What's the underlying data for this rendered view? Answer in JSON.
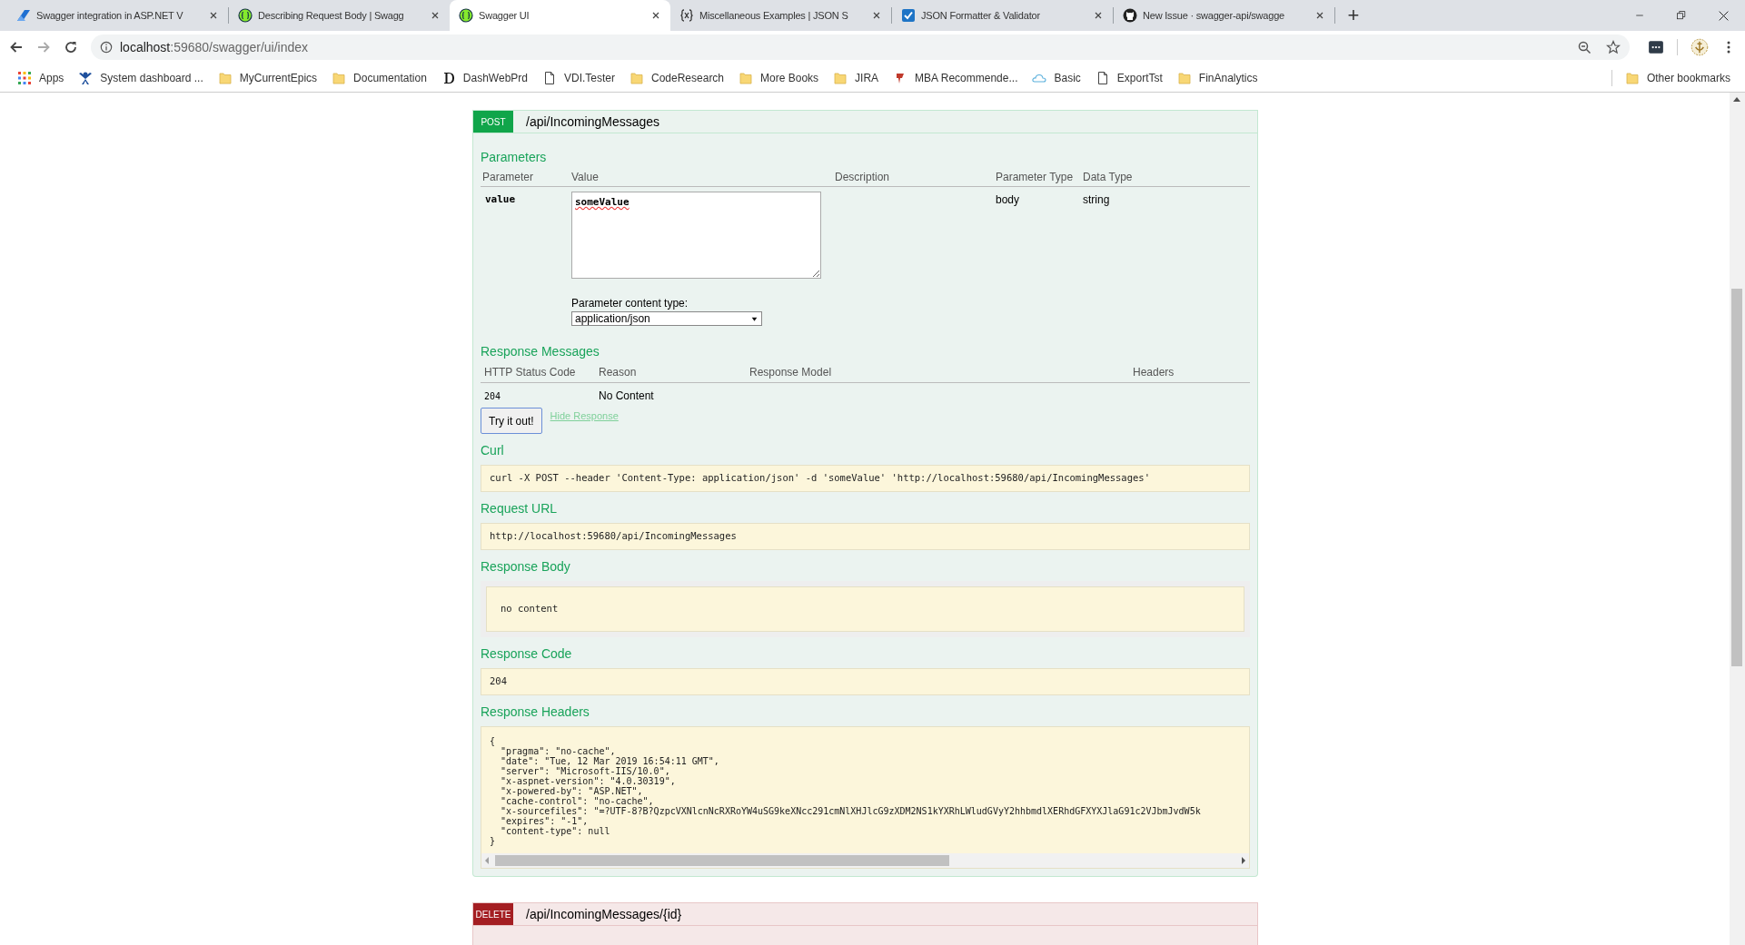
{
  "browser": {
    "tabs": [
      {
        "title": "Swagger integration in ASP.NET V",
        "kind": "logo",
        "selected": false
      },
      {
        "title": "Describing Request Body | Swagg",
        "kind": "swagger",
        "selected": false
      },
      {
        "title": "Swagger UI",
        "kind": "swagger",
        "selected": true
      },
      {
        "title": "Miscellaneous Examples | JSON S",
        "kind": "braces",
        "selected": false
      },
      {
        "title": "JSON Formatter & Validator",
        "kind": "check",
        "selected": false
      },
      {
        "title": "New Issue · swagger-api/swagge",
        "kind": "github",
        "selected": false
      }
    ],
    "new_tab": "+",
    "address": {
      "host": "localhost",
      "rest": ":59680/swagger/ui/index"
    },
    "bookmarks": [
      {
        "label": "Apps",
        "kind": "apps"
      },
      {
        "label": "System dashboard ...",
        "kind": "person"
      },
      {
        "label": "MyCurrentEpics",
        "kind": "folder"
      },
      {
        "label": "Documentation",
        "kind": "folder"
      },
      {
        "label": "DashWebPrd",
        "kind": "letter"
      },
      {
        "label": "VDI.Tester",
        "kind": "page"
      },
      {
        "label": "CodeResearch",
        "kind": "folder"
      },
      {
        "label": "More Books",
        "kind": "folder"
      },
      {
        "label": "JIRA",
        "kind": "folder"
      },
      {
        "label": "MBA Recommende...",
        "kind": "pin"
      },
      {
        "label": "Basic",
        "kind": "cloud"
      },
      {
        "label": "ExportTst",
        "kind": "page"
      },
      {
        "label": "FinAnalytics",
        "kind": "folder"
      }
    ],
    "other_bookmarks": "Other bookmarks"
  },
  "operations": [
    {
      "method": "POST",
      "path": "/api/IncomingMessages",
      "parameters": {
        "title": "Parameters",
        "columns": [
          "Parameter",
          "Value",
          "Description",
          "Parameter Type",
          "Data Type"
        ],
        "rows": [
          {
            "name": "value",
            "value": "someValue",
            "parameter_type": "body",
            "data_type": "string"
          }
        ],
        "content_type_label": "Parameter content type:",
        "content_type": "application/json"
      },
      "responses": {
        "title": "Response Messages",
        "columns": [
          "HTTP Status Code",
          "Reason",
          "Response Model",
          "Headers"
        ],
        "rows": [
          {
            "code": "204",
            "reason": "No Content"
          }
        ]
      },
      "try_button": "Try it out!",
      "hide_link": "Hide Response",
      "results": [
        {
          "title": "Curl",
          "kind": "plain",
          "text": "curl -X POST --header 'Content-Type: application/json' -d 'someValue' 'http://localhost:59680/api/IncomingMessages'"
        },
        {
          "title": "Request URL",
          "kind": "plain",
          "text": "http://localhost:59680/api/IncomingMessages"
        },
        {
          "title": "Response Body",
          "kind": "framed",
          "text": "no content"
        },
        {
          "title": "Response Code",
          "kind": "plain",
          "text": "204"
        },
        {
          "title": "Response Headers",
          "kind": "scroll",
          "lines": [
            "{",
            "  \"pragma\": \"no-cache\",",
            "  \"date\": \"Tue, 12 Mar 2019 16:54:11 GMT\",",
            "  \"server\": \"Microsoft-IIS/10.0\",",
            "  \"x-aspnet-version\": \"4.0.30319\",",
            "  \"x-powered-by\": \"ASP.NET\",",
            "  \"cache-control\": \"no-cache\",",
            "  \"x-sourcefiles\": \"=?UTF-8?B?QzpcVXNlcnNcRXRoYW4uSG9keXNcc291cmNlXHJlcG9zXDM2NS1kYXRhLWludGVyY2hhbmdlXERhdGFXYXJlaG91c2VJbmJvdW5k",
            "  \"expires\": \"-1\",",
            "  \"content-type\": null",
            "}"
          ]
        }
      ]
    },
    {
      "method": "DELETE",
      "path": "/api/IncomingMessages/{id}"
    }
  ]
}
